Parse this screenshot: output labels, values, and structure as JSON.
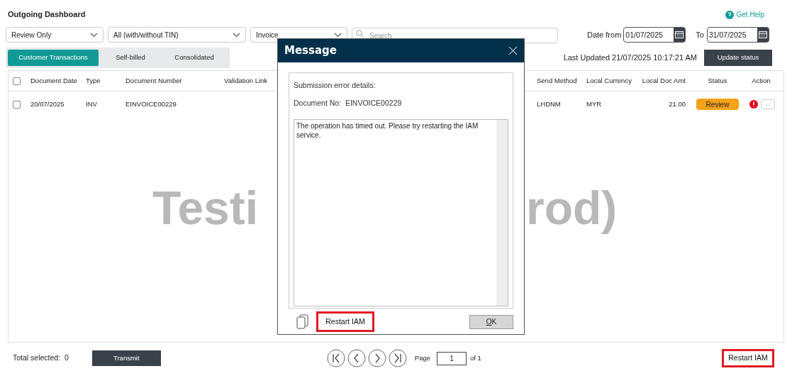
{
  "page": {
    "title": "Outgoing Dashboard",
    "help_link": "Get Help"
  },
  "filters": {
    "dropdowns": [
      {
        "value": "Review Only"
      },
      {
        "value": "All (with/without TIN)"
      },
      {
        "value": "Invoice"
      }
    ],
    "search": {
      "placeholder": "Search"
    },
    "date_from_label": "Date from",
    "date_from": "01/07/2025",
    "date_to_label": "To",
    "date_to": "31/07/2025"
  },
  "tabs": [
    {
      "label": "Customer Transactions",
      "selected": true
    },
    {
      "label": "Self-billed",
      "selected": false
    },
    {
      "label": "Consolidated",
      "selected": false
    }
  ],
  "last_updated": "Last Updated 21/07/2025 10:17:21 AM",
  "update_button": "Update status",
  "table": {
    "select_all_checked": false,
    "columns": [
      "Document Date",
      "Type",
      "Document Number",
      "Validation Link",
      "",
      "Send Method",
      "Local Currency",
      "Local Doc Amt",
      "Status",
      "Action"
    ],
    "rows": [
      {
        "checked": false,
        "document_date": "20/07/2025",
        "type": "INV",
        "document_number": "EINVOICE00229",
        "send_method": "LHDNM",
        "local_currency": "MYR",
        "local_doc_amt": "21.00",
        "status": "Review",
        "error": true,
        "action": "..."
      }
    ],
    "background_banner": [
      "Testi",
      "rod)"
    ]
  },
  "footer": {
    "total_selected": "Total selected:  0",
    "transmit": "Transmit",
    "page_label": "Page",
    "page": "1",
    "page_of": "of 1",
    "restart": {
      "label": "Restart IAM",
      "highlighted": true
    }
  },
  "dialog": {
    "title": "Message",
    "heading": "Submission error details:",
    "document_no": "Document No:  EINVOICE00229",
    "message": "The operation has timed out. Please try restarting the IAM service.",
    "restart": {
      "label": "Restart IAM",
      "highlighted": true
    },
    "ok": "OK"
  }
}
